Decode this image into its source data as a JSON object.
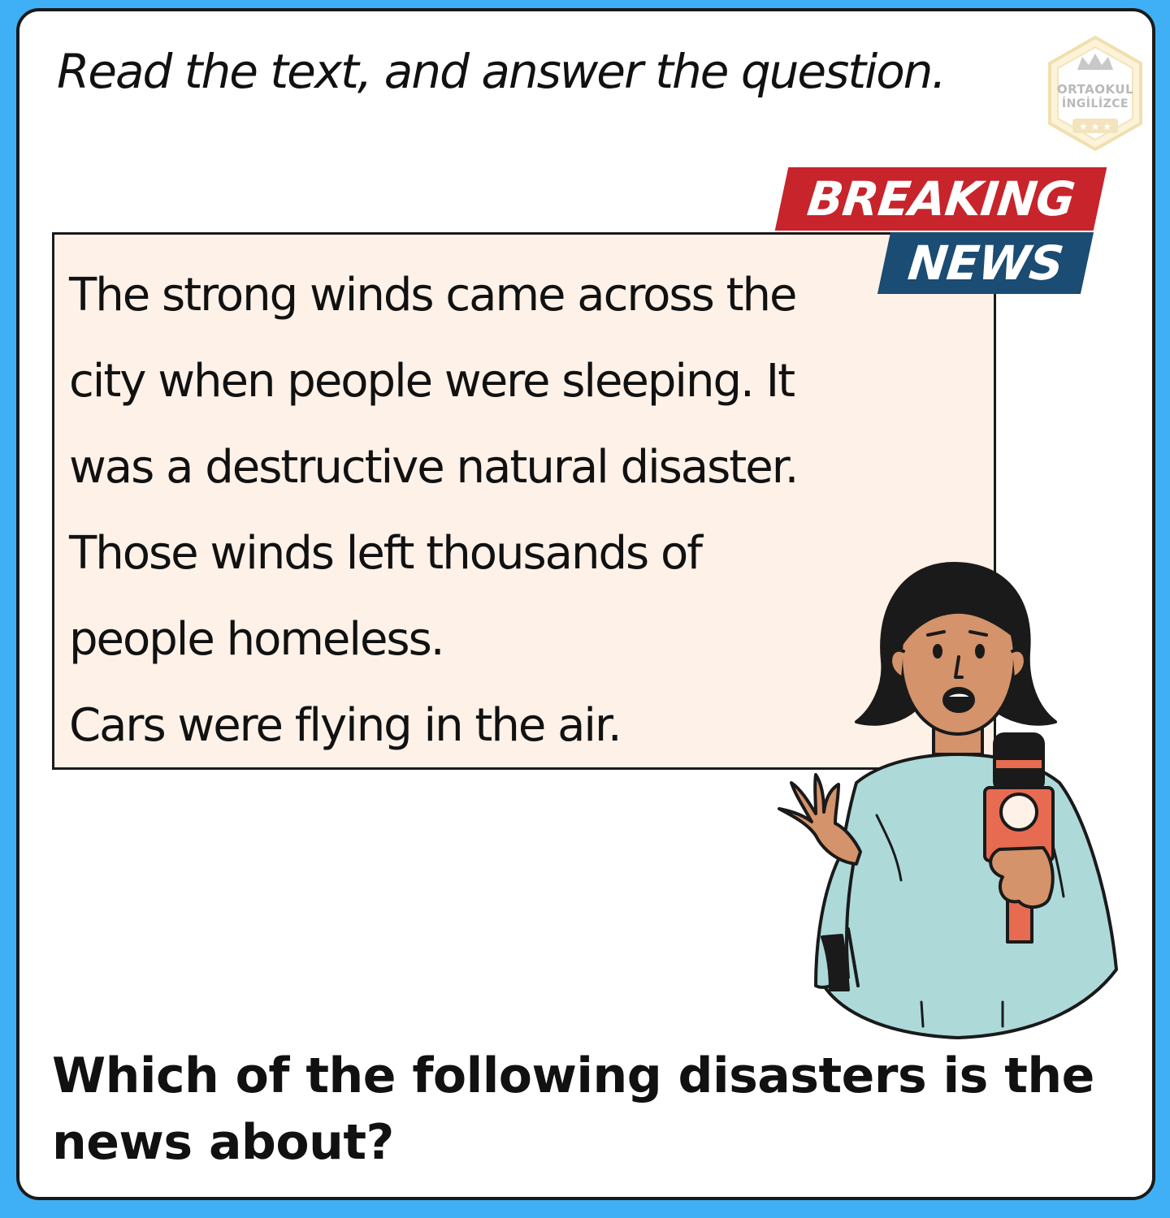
{
  "instruction": "Read the text, and answer the question.",
  "logo": {
    "line1": "ORTAOKUL",
    "line2": "İNGİLİZCE",
    "icon": "crown-shield-logo"
  },
  "badge": {
    "top_text": "BREAKING",
    "bottom_text": "NEWS",
    "top_color": "#c7242b",
    "bottom_color": "#1b4c73"
  },
  "passage": {
    "lines": [
      "The strong winds came across the",
      "city when people were sleeping. It",
      "was a destructive natural disaster.",
      "Those winds left thousands of",
      "people homeless.",
      "Cars were flying in the air."
    ]
  },
  "question": "Which of the following disasters is the news about?",
  "colors": {
    "page_border": "#3fb0f5",
    "passage_bg": "#fdf1e8"
  }
}
